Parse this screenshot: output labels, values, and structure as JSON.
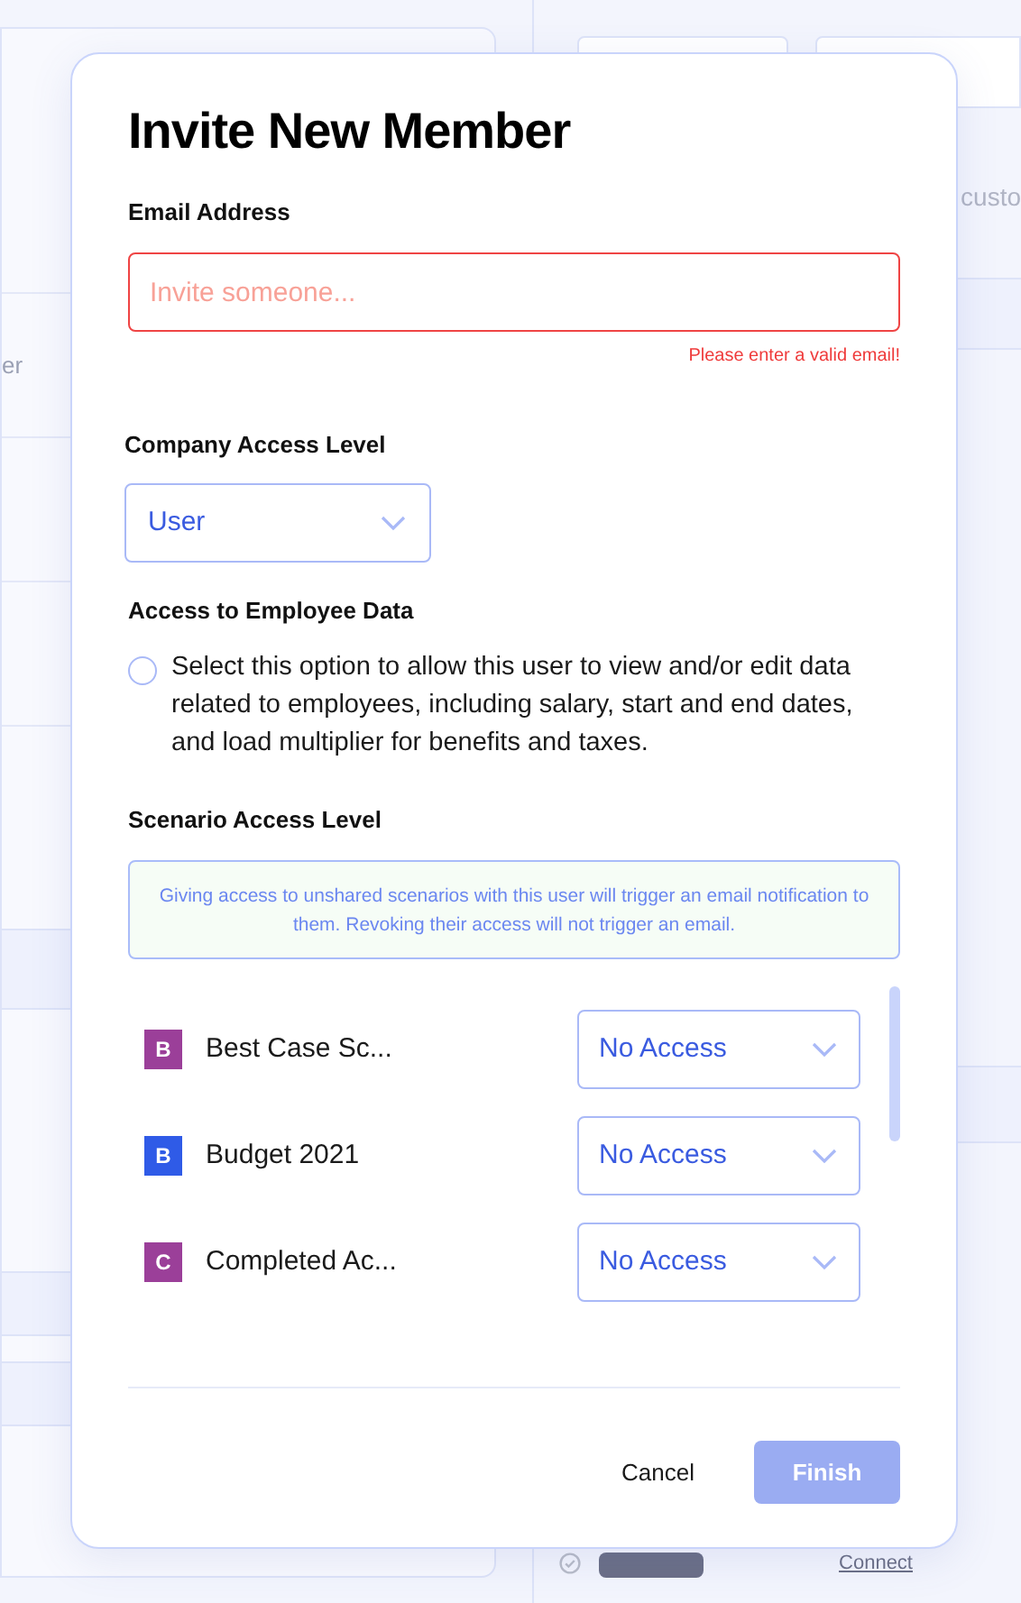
{
  "background": {
    "left_text": "er",
    "right_text": "custo",
    "integration": {
      "action": "Connect"
    }
  },
  "dialog": {
    "title": "Invite New Member",
    "email": {
      "label": "Email Address",
      "placeholder": "Invite someone...",
      "error": "Please enter a valid email!",
      "invalid": true
    },
    "company_access": {
      "label": "Company Access Level",
      "value": "User"
    },
    "employee_data": {
      "label": "Access to Employee Data",
      "option": "Select this option to allow this user to view and/or edit data related to employees, including salary, start and end dates, and load multiplier for benefits and taxes.",
      "selected": false
    },
    "scenario_access": {
      "label": "Scenario Access Level",
      "notice": "Giving access to unshared scenarios with this user will trigger an email notification to them. Revoking their access will not trigger an email.",
      "scenarios": [
        {
          "initial": "B",
          "name": "Best Case Sc...",
          "color": "#9b3f99",
          "access": "No Access"
        },
        {
          "initial": "B",
          "name": "Budget 2021",
          "color": "#2f5be7",
          "access": "No Access"
        },
        {
          "initial": "C",
          "name": "Completed Ac...",
          "color": "#9b3f99",
          "access": "No Access"
        }
      ]
    },
    "buttons": [
      {
        "label": "Cancel",
        "kind": "secondary",
        "disabled": false
      },
      {
        "label": "Finish",
        "kind": "primary",
        "disabled": true
      }
    ]
  }
}
